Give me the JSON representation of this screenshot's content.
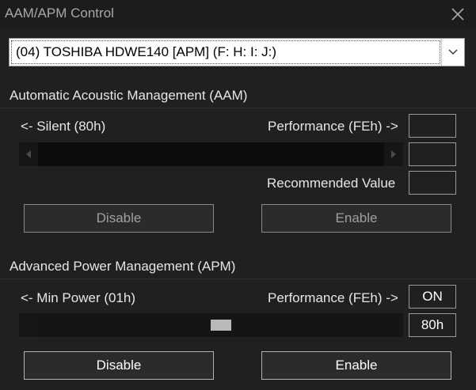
{
  "window": {
    "title": "AAM/APM Control"
  },
  "drive_select": {
    "value": "(04) TOSHIBA HDWE140 [APM] (F: H: I: J:)"
  },
  "aam": {
    "section_title": "Automatic Acoustic Management (AAM)",
    "min_label": "<- Silent (80h)",
    "max_label": "Performance (FEh) ->",
    "status_value": "",
    "current_value": "",
    "recommended_label": "Recommended Value",
    "recommended_value": "",
    "disable_label": "Disable",
    "enable_label": "Enable"
  },
  "apm": {
    "section_title": "Advanced Power Management (APM)",
    "min_label": "<- Min Power (01h)",
    "max_label": "Performance (FEh) ->",
    "status_value": "ON",
    "current_value": "80h",
    "slider_level": 0.5,
    "disable_label": "Disable",
    "enable_label": "Enable"
  },
  "colors": {
    "background": "#202020",
    "text": "#e6e6e6",
    "border": "#9a9a9a"
  }
}
